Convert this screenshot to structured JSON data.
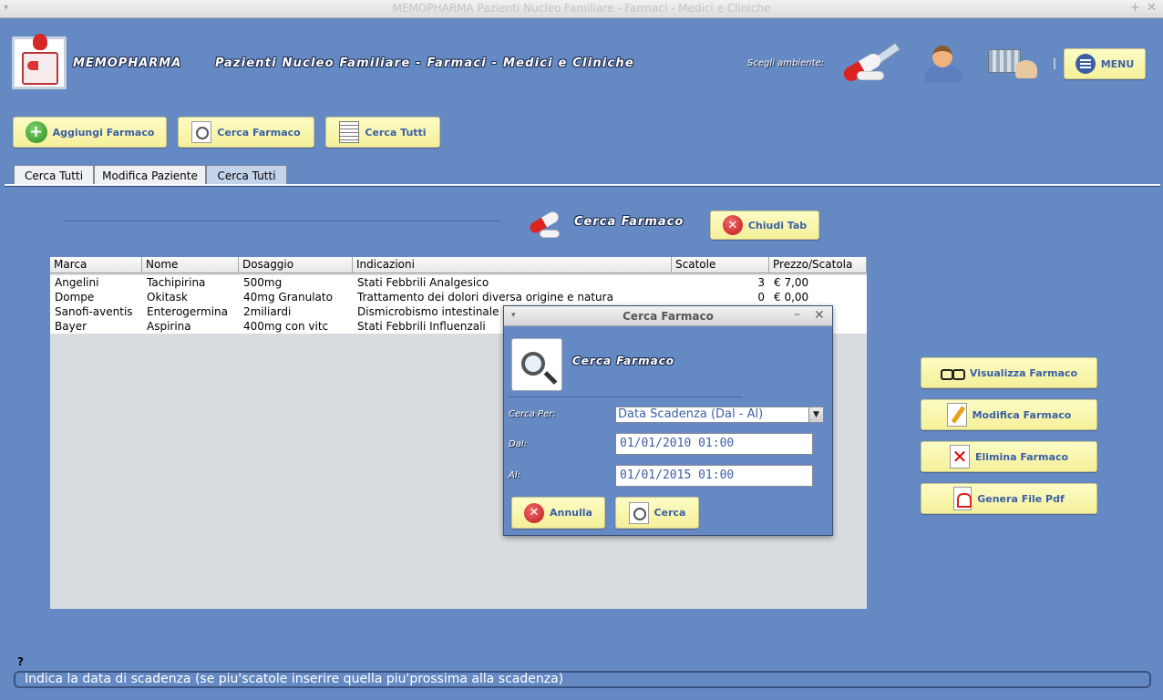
{
  "window": {
    "title": "MEMOPHARMA    Pazienti Nucleo Familiare - Farmaci - Medici e Cliniche",
    "menu_glyph": "▾",
    "pin_glyph": "+",
    "close_glyph": "✕"
  },
  "header": {
    "brand": "MEMOPHARMA",
    "subtitle": "Pazienti Nucleo Familiare - Farmaci - Medici e Cliniche",
    "env_label": "Scegli ambiente:",
    "separator": "|",
    "menu_label": "MENU"
  },
  "toolbar": {
    "add_label": "Aggiungi Farmaco",
    "search_label": "Cerca Farmaco",
    "search_all_label": "Cerca Tutti"
  },
  "tabs": [
    {
      "label": "Cerca Tutti"
    },
    {
      "label": "Modifica Paziente"
    },
    {
      "label": "Cerca Tutti"
    }
  ],
  "section": {
    "title": "Cerca Farmaco",
    "close_tab_label": "Chiudi Tab"
  },
  "table": {
    "columns": [
      "Marca",
      "Nome",
      "Dosaggio",
      "Indicazioni",
      "Scatole",
      "Prezzo/Scatola"
    ],
    "rows": [
      [
        "Angelini",
        "Tachipirina",
        "500mg",
        "Stati Febbrili Analgesico",
        "3",
        "€ 7,00"
      ],
      [
        "Dompe",
        "Okitask",
        "40mg Granulato",
        "Trattamento dei dolori diversa origine e natura",
        "0",
        "€ 0,00"
      ],
      [
        "Sanofi-aventis",
        "Enterogermina",
        "2miliardi",
        "Dismicrobismo intestinale",
        "",
        ""
      ],
      [
        "Bayer",
        "Aspirina",
        "400mg con vitc",
        "Stati Febbrili Influenzali",
        "",
        ""
      ]
    ]
  },
  "side_buttons": {
    "view": "Visualizza Farmaco",
    "edit": "Modifica Farmaco",
    "delete": "Elimina Farmaco",
    "pdf": "Genera File Pdf"
  },
  "dialog": {
    "title": "Cerca Farmaco",
    "menu_glyph": "▾",
    "minimize_glyph": "–",
    "close_glyph": "✕",
    "heading": "Cerca Farmaco",
    "search_by_label": "Cerca Per:",
    "search_by_value": "Data Scadenza (Dal - Al)",
    "select_arrow": "▼",
    "from_label": "Dal:",
    "from_value": "01/01/2010 01:00",
    "to_label": "Al:",
    "to_value": "01/01/2015 01:00",
    "cancel_label": "Annulla",
    "search_label": "Cerca"
  },
  "status": {
    "marker": "?",
    "message": "Indica la data di scadenza (se piu'scatole inserire quella piu'prossima alla scadenza)"
  },
  "icons": {
    "plus": "+",
    "x": "✕"
  },
  "colors": {
    "background": "#6589c2",
    "button_yellow": "#f4f09a",
    "button_text": "#3b5fa6"
  }
}
